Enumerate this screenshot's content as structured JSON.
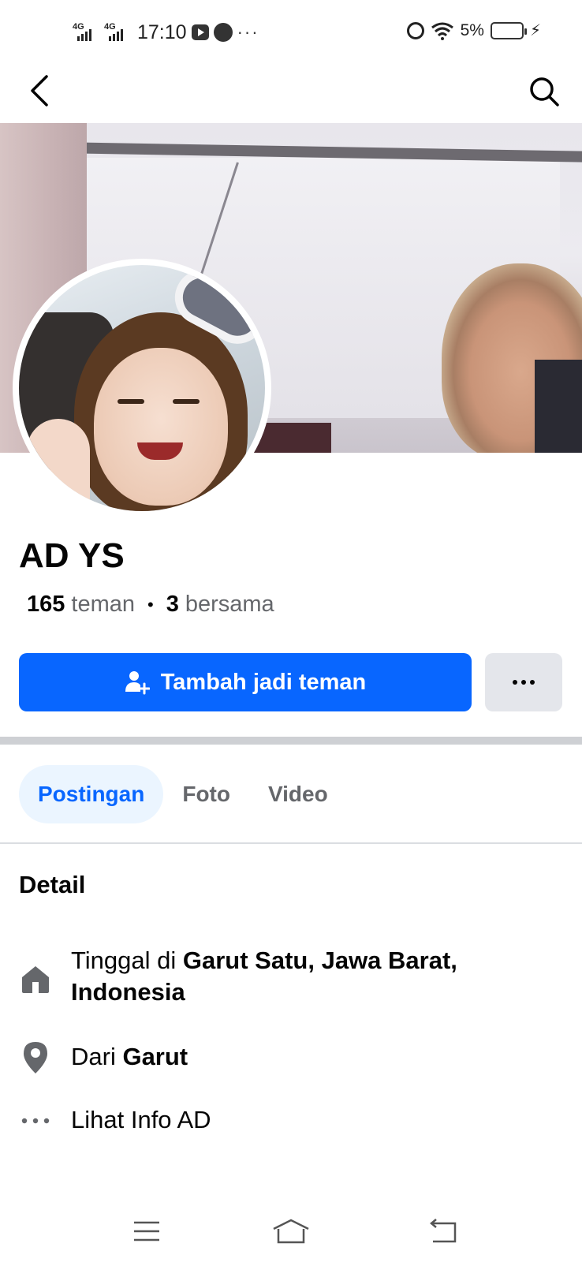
{
  "status_bar": {
    "network_1": "4G",
    "network_2": "4G",
    "time": "17:10",
    "more": "···",
    "battery_percent": "5%"
  },
  "header": {
    "back_icon": "chevron-left-icon",
    "search_icon": "search-icon"
  },
  "profile": {
    "name": "AD YS",
    "friends_count": "165",
    "friends_label": "teman",
    "separator": "•",
    "mutual_count": "3",
    "mutual_label": "bersama"
  },
  "actions": {
    "add_friend_label": "Tambah jadi teman",
    "add_friend_icon": "add-friend-icon",
    "more_icon": "more-dots-icon"
  },
  "tabs": [
    {
      "label": "Postingan",
      "active": true
    },
    {
      "label": "Foto",
      "active": false
    },
    {
      "label": "Video",
      "active": false
    }
  ],
  "details": {
    "title": "Detail",
    "lives_prefix": "Tinggal di ",
    "lives_place": "Garut Satu, Jawa Barat, Indonesia",
    "from_prefix": "Dari ",
    "from_place": "Garut",
    "see_info": "Lihat Info AD"
  },
  "colors": {
    "brand_blue": "#0866ff",
    "tab_active_bg": "#ebf5ff",
    "secondary_text": "#65676b",
    "button_grey": "#e4e6eb"
  }
}
